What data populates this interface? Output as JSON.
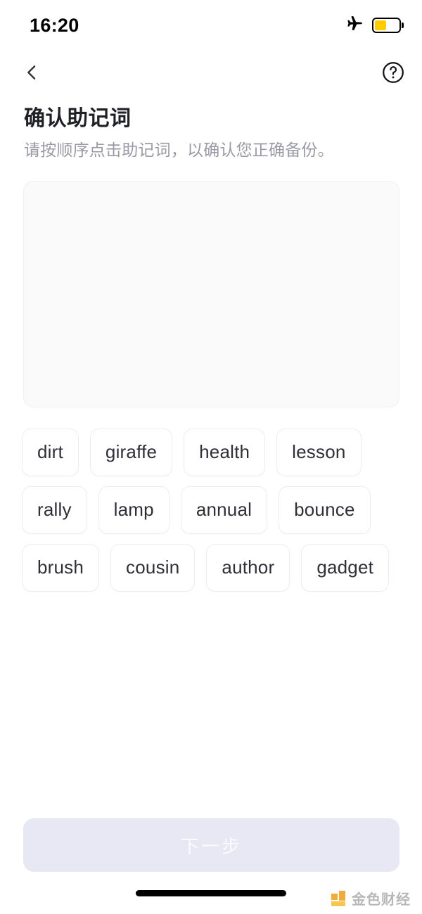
{
  "status_bar": {
    "time": "16:20",
    "airplane_icon": "airplane-icon",
    "battery_icon": "battery-icon",
    "battery_level_percent": 44,
    "battery_color": "#ffcc00"
  },
  "nav": {
    "back_icon": "chevron-left-icon",
    "help_icon": "question-mark-circle-icon"
  },
  "page": {
    "title": "确认助记词",
    "subtitle": "请按顺序点击助记词，以确认您正确备份。"
  },
  "answer_panel": {
    "selected_words": []
  },
  "word_bank": {
    "words": [
      "dirt",
      "giraffe",
      "health",
      "lesson",
      "rally",
      "lamp",
      "annual",
      "bounce",
      "brush",
      "cousin",
      "author",
      "gadget"
    ]
  },
  "footer": {
    "next_label": "下一步",
    "next_disabled": true,
    "next_bg_color": "#e8e8f5",
    "next_text_color": "#fbfbfe"
  },
  "watermark": {
    "text": "金色财经",
    "logo_color": "#f0a42a"
  }
}
